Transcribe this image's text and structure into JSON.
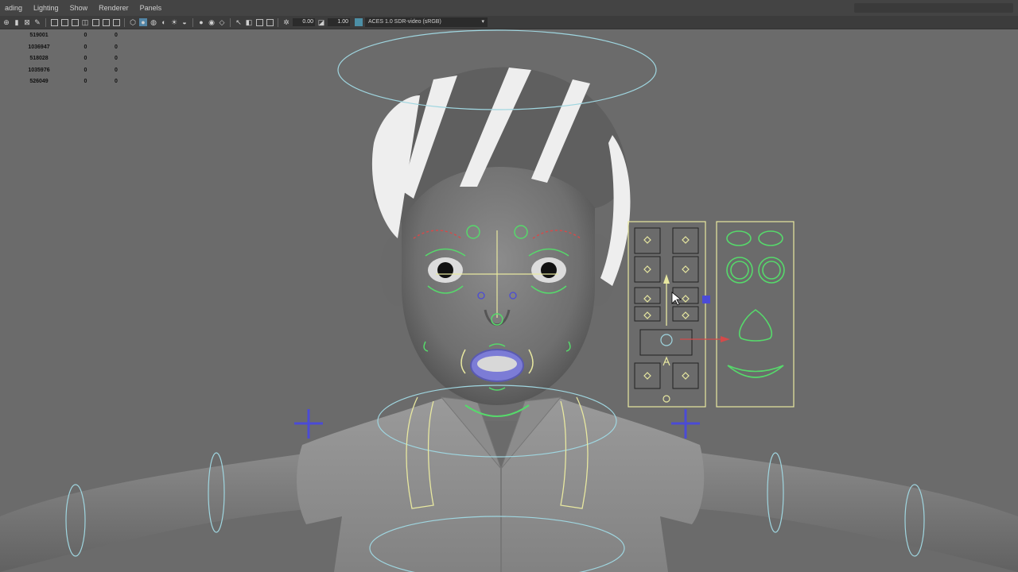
{
  "menubar": {
    "items": [
      "ading",
      "Lighting",
      "Show",
      "Renderer",
      "Panels"
    ]
  },
  "toolbar": {
    "field_exposure": "0.00",
    "field_gamma": "1.00",
    "color_management": "ACES 1.0 SDR-video (sRGB)"
  },
  "hud": {
    "rows": [
      [
        "519001",
        "0",
        "0"
      ],
      [
        "1036947",
        "0",
        "0"
      ],
      [
        "518028",
        "0",
        "0"
      ],
      [
        "1035976",
        "0",
        "0"
      ],
      [
        "526049",
        "0",
        "0"
      ]
    ]
  },
  "colors": {
    "viewport_bg": "#6b6b6b",
    "menubar_bg": "#444444",
    "toolbar_bg": "#3c3c3c",
    "rig_cyan": "#9fd6e0",
    "rig_yellow": "#e8e8a0",
    "rig_green": "#56d96b",
    "rig_red": "#d44a4a",
    "rig_blue": "#4b4bd6"
  }
}
